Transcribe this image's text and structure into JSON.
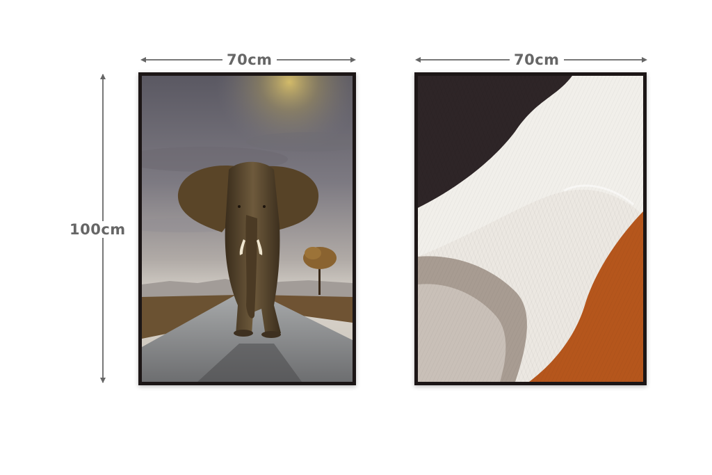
{
  "dimensions": {
    "left_width": "70cm",
    "right_width": "70cm",
    "height": "100cm"
  },
  "artworks": [
    {
      "subject": "elephant-on-road-photo"
    },
    {
      "subject": "abstract-textured-layers"
    }
  ],
  "colors": {
    "frame": "#1c1616",
    "dimension_line": "#777777",
    "dimension_text": "#666666",
    "abstract_dark": "#2e2527",
    "abstract_cream": "#ece8e2",
    "abstract_taupe": "#a89c92",
    "abstract_rust": "#b5561c"
  }
}
